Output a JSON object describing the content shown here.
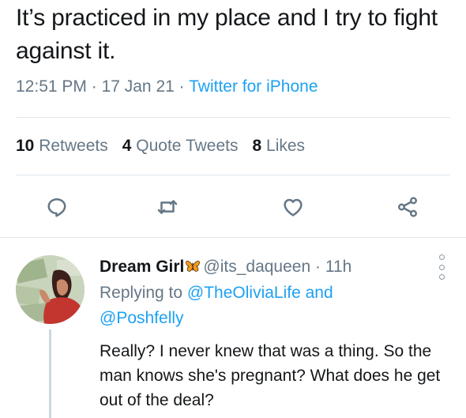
{
  "tweet": {
    "text": "It’s practiced in my place and I try to fight against it.",
    "time": "12:51 PM",
    "sep1": " · ",
    "date": "17 Jan 21",
    "sep2": " · ",
    "source": "Twitter for iPhone"
  },
  "stats": {
    "retweets_count": "10",
    "retweets_label": "Retweets",
    "quotes_count": "4",
    "quotes_label": "Quote Tweets",
    "likes_count": "8",
    "likes_label": "Likes"
  },
  "actions": [
    "reply-icon",
    "retweet-icon",
    "like-icon",
    "share-icon"
  ],
  "reply": {
    "display_name": "Dream Girl",
    "name_emoji": "butterfly-icon",
    "handle": "@its_daqueen",
    "sep": " · ",
    "time": "11h",
    "replying_prefix": "Replying to ",
    "replying_to_1": "@TheOliviaLife",
    "replying_and": " and",
    "replying_to_2": "@Poshfelly",
    "text": "Really? I never knew that was a thing. So the man knows she's pregnant? What does he get out of the deal?"
  },
  "colors": {
    "link": "#1da1f2",
    "secondary": "#657786",
    "divider": "#e1e8ed"
  }
}
